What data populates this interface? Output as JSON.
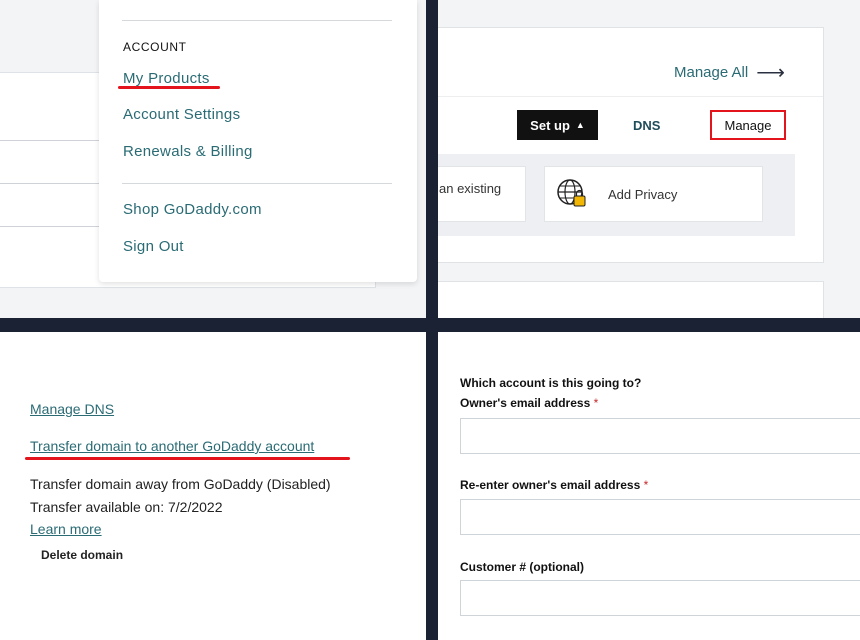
{
  "account_menu": {
    "heading": "ACCOUNT",
    "items": [
      "My Products",
      "Account Settings",
      "Renewals & Billing"
    ],
    "secondary_items": [
      "Shop GoDaddy.com",
      "Sign Out"
    ]
  },
  "products_panel": {
    "manage_all_label": "Manage All",
    "setup_label": "Set up",
    "dns_label": "DNS",
    "manage_label": "Manage",
    "tile_partial_text": "an existing",
    "add_privacy_label": "Add Privacy"
  },
  "domain_settings": {
    "manage_dns_link": "Manage DNS",
    "transfer_internal_link": "Transfer domain to another GoDaddy account",
    "transfer_away_text": "Transfer domain away from GoDaddy (Disabled)",
    "transfer_available_text": "Transfer available on: 7/2/2022",
    "learn_more_link": "Learn more",
    "delete_domain_label": "Delete domain"
  },
  "transfer_form": {
    "question": "Which account is this going to?",
    "owner_email_label": "Owner's email address",
    "reenter_email_label": "Re-enter owner's email address",
    "customer_number_label": "Customer # (optional)",
    "required_marker": "*",
    "owner_email_value": "",
    "reenter_email_value": "",
    "customer_number_value": ""
  },
  "colors": {
    "link_teal": "#2a6b74",
    "highlight_red": "#e3141b",
    "divider_navy": "#1b2233"
  },
  "icons": {
    "arrow": "arrow-right-icon",
    "caret": "caret-up-icon",
    "privacy": "globe-lock-icon"
  }
}
